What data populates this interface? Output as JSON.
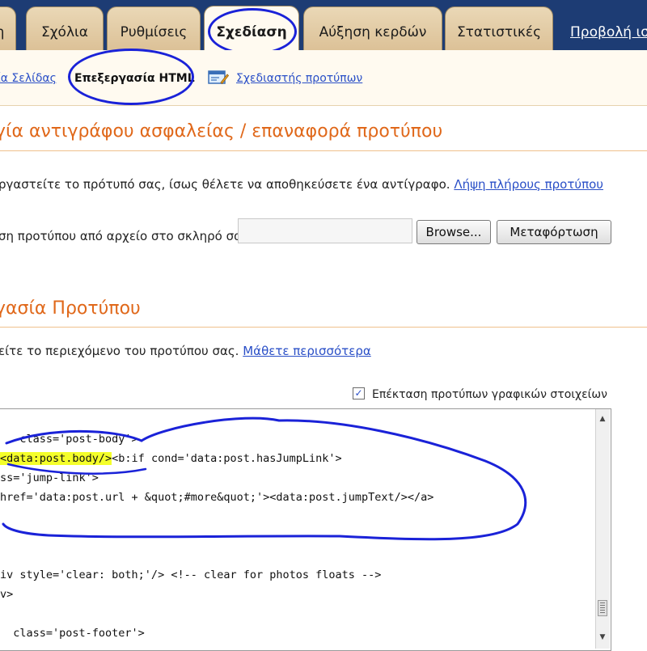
{
  "tabs": [
    {
      "label": "η"
    },
    {
      "label": "Σχόλια"
    },
    {
      "label": "Ρυθμίσεις"
    },
    {
      "label": "Σχεδίαση"
    },
    {
      "label": "Αύξηση κερδών"
    },
    {
      "label": "Στατιστικές"
    }
  ],
  "view_link": "Προβολή ισ",
  "subtabs": {
    "page_elements": "ία Σελίδας",
    "edit_html": "Επεξεργασία HTML",
    "template_designer": "Σχεδιαστής προτύπων"
  },
  "backup": {
    "title": "γία αντιγράφου ασφαλείας / επαναφορά προτύπου",
    "intro": "ργαστείτε το πρότυπό σας, ίσως θέλετε να αποθηκεύσετε ένα αντίγραφο.",
    "download_link": "Λήψη πλήρους προτύπου",
    "upload_label": "ση προτύπου από αρχείο στο σκληρό σας:",
    "browse_button": "Browse...",
    "upload_button": "Μεταφόρτωση"
  },
  "edit": {
    "title": "γασία Προτύπου",
    "intro": "είτε το περιεχόμενο του προτύπου σας.",
    "learn_more": "Μάθετε περισσότερα",
    "expand_label": "Επέκταση προτύπων γραφικών στοιχείων",
    "expand_checked": true
  },
  "code_lines": {
    "line1": "   class='post-body'>",
    "line2_hl": "<data:post.body/>",
    "line2_rest": "<b:if cond='data:post.hasJumpLink'>",
    "line3": "ss='jump-link'>",
    "line4": "href='data:post.url + &quot;#more&quot;'><data:post.jumpText/></a>",
    "line5": "iv style='clear: both;'/> <!-- clear for photos floats -->",
    "line6": "v>",
    "line7": "  class='post-footer'>"
  },
  "colors": {
    "topbar": "#1d3c74",
    "section_title": "#e0681a",
    "link": "#2a4fc7",
    "annotation": "#1a22d8",
    "highlight": "#f4ff2a"
  }
}
